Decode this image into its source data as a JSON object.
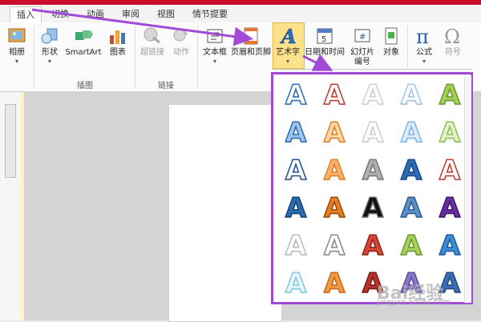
{
  "tabs": [
    {
      "label": "插入",
      "active": true
    },
    {
      "label": "切换",
      "active": false
    },
    {
      "label": "动画",
      "active": false
    },
    {
      "label": "审阅",
      "active": false
    },
    {
      "label": "视图",
      "active": false
    },
    {
      "label": "情节提要",
      "active": false
    }
  ],
  "ribbon": {
    "buttons": [
      {
        "label": "相册",
        "icon": "photo-album-icon",
        "disabled": false
      },
      {
        "label": "形状",
        "icon": "shapes-icon",
        "disabled": false
      },
      {
        "label": "SmartArt",
        "icon": "smartart-icon",
        "disabled": false
      },
      {
        "label": "图表",
        "icon": "chart-icon",
        "disabled": false
      },
      {
        "label": "超链接",
        "icon": "hyperlink-icon",
        "disabled": true
      },
      {
        "label": "动作",
        "icon": "action-icon",
        "disabled": true
      },
      {
        "label": "文本框",
        "icon": "textbox-icon",
        "disabled": false
      },
      {
        "label": "页眉和页脚",
        "icon": "header-footer-icon",
        "disabled": false
      },
      {
        "label": "艺术字",
        "icon": "wordart-icon",
        "disabled": false
      },
      {
        "label": "日期和时间",
        "icon": "date-time-icon",
        "disabled": false
      },
      {
        "label": "幻灯片",
        "label2": "编号",
        "icon": "slide-number-icon",
        "disabled": false
      },
      {
        "label": "对象",
        "icon": "object-icon",
        "disabled": false
      },
      {
        "label": "公式",
        "icon": "equation-icon",
        "disabled": false
      },
      {
        "label": "符号",
        "icon": "symbol-icon",
        "disabled": true
      }
    ],
    "groups": [
      "插图",
      "链接"
    ]
  },
  "gallery": {
    "letter": "A",
    "colors": {
      "purple_border": "#a14ad7",
      "blue": "#2b6cb5",
      "red": "#c0392b",
      "green": "#8ac149",
      "orange": "#e67e22",
      "gray": "#8a8a8a"
    }
  },
  "watermark": {
    "text": "Bai经验",
    "sub": "jingyan.baidu.com"
  }
}
